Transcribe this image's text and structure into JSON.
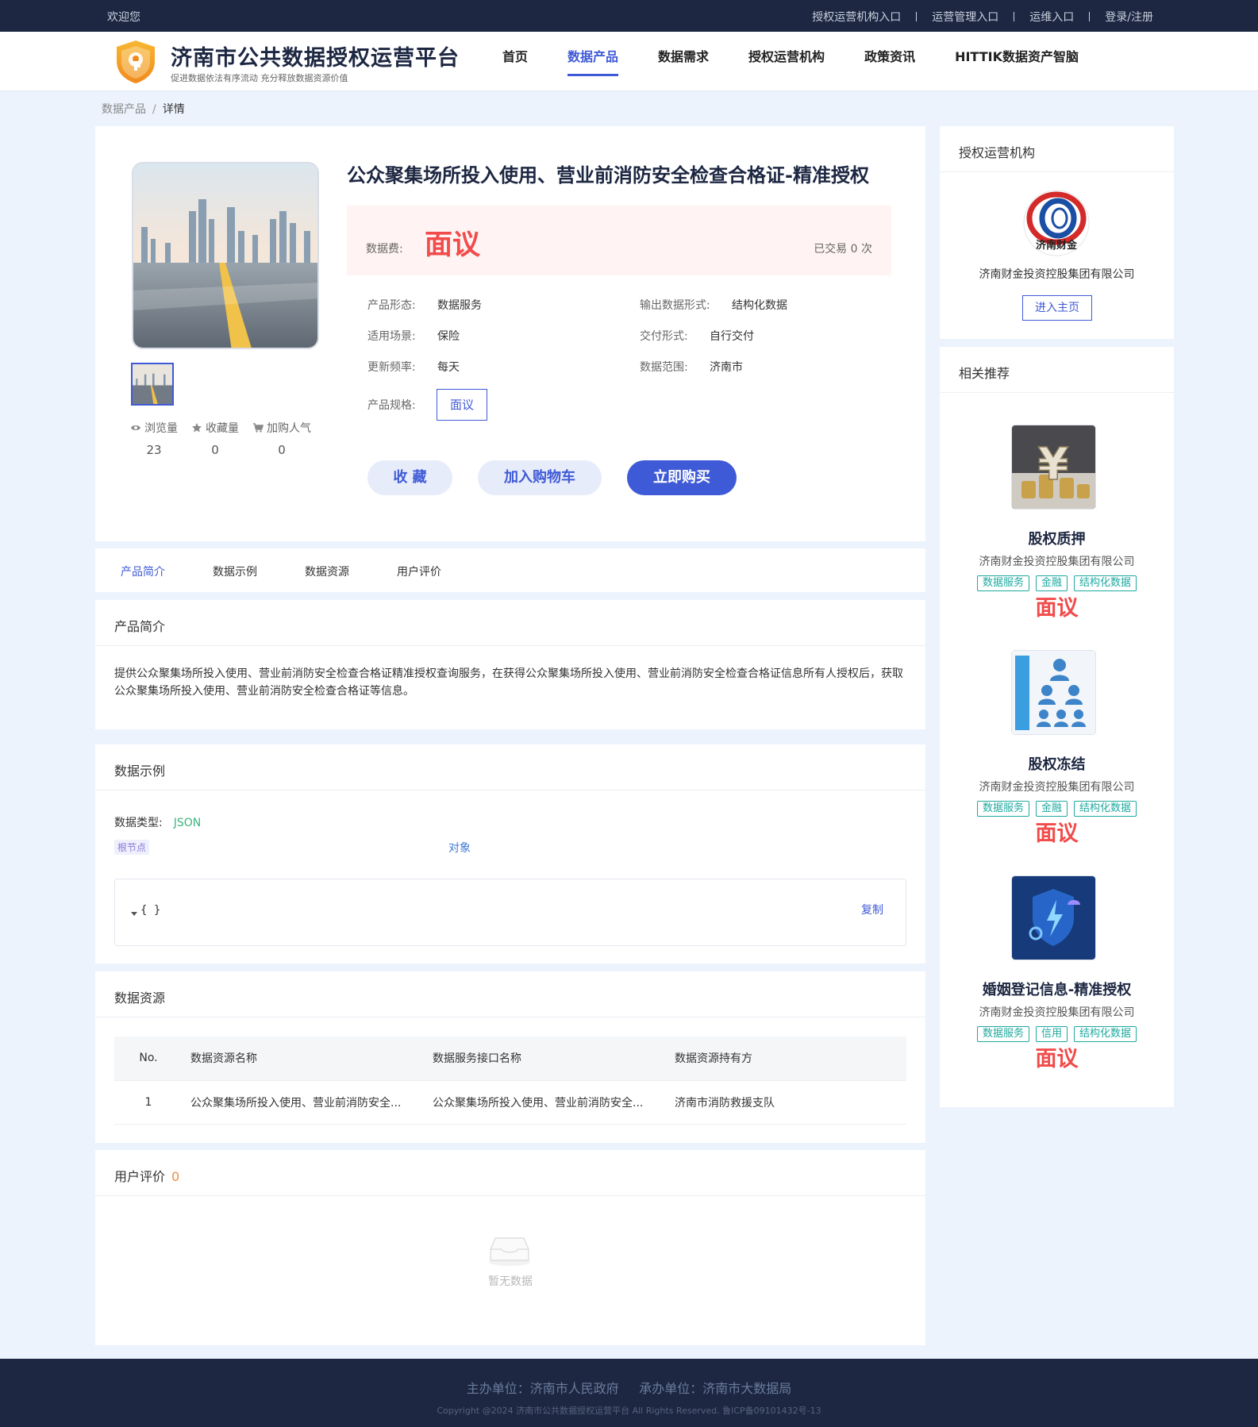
{
  "topbar": {
    "welcome": "欢迎您",
    "links": [
      "授权运营机构入口",
      "运营管理入口",
      "运维入口",
      "登录/注册"
    ]
  },
  "header": {
    "title": "济南市公共数据授权运营平台",
    "subtitle": "促进数据依法有序流动 充分释放数据资源价值",
    "nav": [
      "首页",
      "数据产品",
      "数据需求",
      "授权运营机构",
      "政策资讯",
      "HITTIK数据资产智脑"
    ],
    "active_nav": "数据产品"
  },
  "breadcrumb": {
    "parent": "数据产品",
    "current": "详情"
  },
  "product": {
    "title": "公众聚集场所投入使用、营业前消防安全检查合格证-精准授权",
    "price_label": "数据费:",
    "price": "面议",
    "traded": "已交易 0 次",
    "attributes": {
      "form_label": "产品形态:",
      "form": "数据服务",
      "output_label": "输出数据形式:",
      "output": "结构化数据",
      "scene_label": "适用场景:",
      "scene": "保险",
      "delivery_label": "交付形式:",
      "delivery": "自行交付",
      "freq_label": "更新频率:",
      "freq": "每天",
      "range_label": "数据范围:",
      "range": "济南市",
      "spec_label": "产品规格:",
      "spec": "面议"
    },
    "stats": [
      {
        "label": "浏览量",
        "value": "23",
        "icon": "eye-icon"
      },
      {
        "label": "收藏量",
        "value": "0",
        "icon": "star-icon"
      },
      {
        "label": "加购人气",
        "value": "0",
        "icon": "cart-icon"
      }
    ],
    "buttons": {
      "favorite": "收 藏",
      "cart": "加入购物车",
      "buy": "立即购买"
    }
  },
  "tabs": [
    "产品简介",
    "数据示例",
    "数据资源",
    "用户评价"
  ],
  "intro": {
    "title": "产品简介",
    "text": "提供公众聚集场所投入使用、营业前消防安全检查合格证精准授权查询服务，在获得公众聚集场所投入使用、营业前消防安全检查合格证信息所有人授权后，获取公众聚集场所投入使用、营业前消防安全检查合格证等信息。"
  },
  "example": {
    "title": "数据示例",
    "type_label": "数据类型:",
    "type": "JSON",
    "root_tag": "根节点",
    "object_label": "对象",
    "code": "{ }",
    "copy": "复制"
  },
  "resources": {
    "title": "数据资源",
    "headers": [
      "No.",
      "数据资源名称",
      "数据服务接口名称",
      "数据资源持有方"
    ],
    "rows": [
      [
        "1",
        "公众聚集场所投入使用、营业前消防安全...",
        "公众聚集场所投入使用、营业前消防安全...",
        "济南市消防救援支队"
      ]
    ]
  },
  "reviews": {
    "title": "用户评价",
    "count": "0",
    "empty": "暂无数据"
  },
  "org": {
    "section_title": "授权运营机构",
    "logo_text": "济南财金",
    "name": "济南财金投资控股集团有限公司",
    "button": "进入主页"
  },
  "recommend": {
    "section_title": "相关推荐",
    "items": [
      {
        "name": "股权质押",
        "org": "济南财金投资控股集团有限公司",
        "tags": [
          "数据服务",
          "金融",
          "结构化数据"
        ],
        "price": "面议"
      },
      {
        "name": "股权冻结",
        "org": "济南财金投资控股集团有限公司",
        "tags": [
          "数据服务",
          "金融",
          "结构化数据"
        ],
        "price": "面议"
      },
      {
        "name": "婚姻登记信息-精准授权",
        "org": "济南财金投资控股集团有限公司",
        "tags": [
          "数据服务",
          "信用",
          "结构化数据"
        ],
        "price": "面议"
      }
    ]
  },
  "footer": {
    "line1": "主办单位：济南市人民政府     承办单位：济南市大数据局",
    "line2": "Copyright @2024 济南市公共数据授权运营平台 All Rights Reserved. 鲁ICP备09101432号-13"
  },
  "colors": {
    "accent": "#3f5ad6",
    "price": "#f24b4b",
    "dark": "#1d2742",
    "tag": "#1fa9a0",
    "bg": "#ecf3fd"
  }
}
